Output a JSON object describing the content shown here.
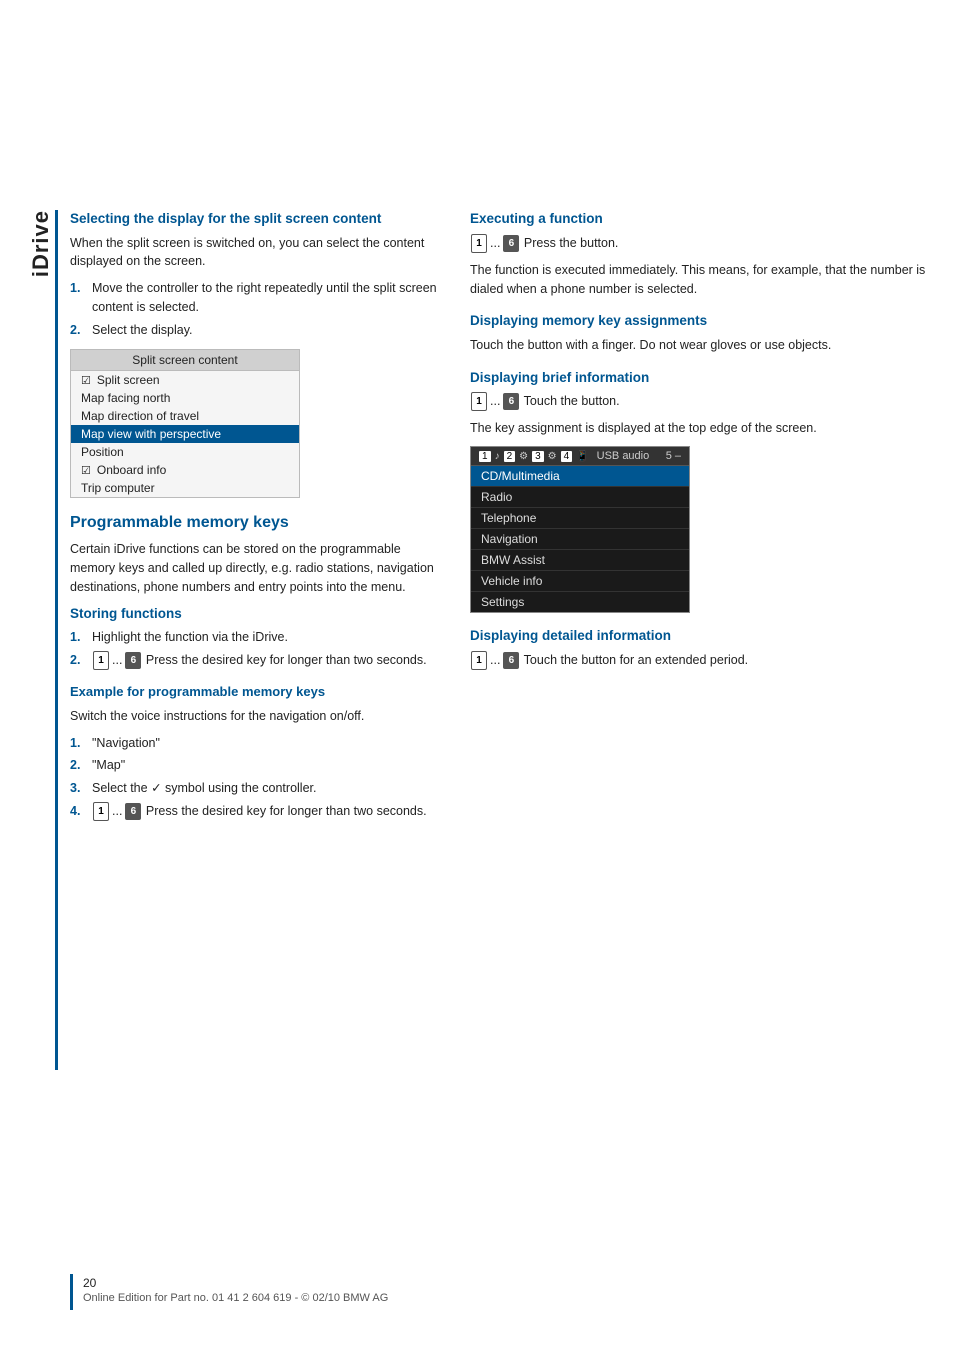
{
  "idrive_label": "iDrive",
  "left_column": {
    "section1": {
      "heading": "Selecting the display for the split screen content",
      "body": "When the split screen is switched on, you can select the content displayed on the screen.",
      "steps": [
        "Move the controller to the right repeatedly until the split screen content is selected.",
        "Select the display."
      ],
      "split_screen_menu": {
        "title": "Split screen content",
        "items": [
          {
            "text": "Split screen",
            "check": true,
            "highlighted": false
          },
          {
            "text": "Map facing north",
            "highlighted": false
          },
          {
            "text": "Map direction of travel",
            "highlighted": false
          },
          {
            "text": "Map view with perspective",
            "highlighted": true
          },
          {
            "text": "Position",
            "highlighted": false
          },
          {
            "text": "Onboard info",
            "check": true,
            "highlighted": false
          },
          {
            "text": "Trip computer",
            "highlighted": false
          }
        ]
      }
    },
    "section2": {
      "heading": "Programmable memory keys",
      "intro": "Certain iDrive functions can be stored on the programmable memory keys and called up directly, e.g. radio stations, navigation destinations, phone numbers and entry points into the menu.",
      "storing_heading": "Storing functions",
      "storing_steps": [
        "Highlight the function via the iDrive.",
        "Press the desired key for longer than two seconds."
      ],
      "example_heading": "Example for programmable memory keys",
      "example_body": "Switch the voice instructions for the navigation on/off.",
      "example_steps": [
        {
          "num": "1.",
          "text": "\"Navigation\""
        },
        {
          "num": "2.",
          "text": "\"Map\""
        },
        {
          "num": "3.",
          "text": "Select the ✓ symbol using the controller."
        },
        {
          "num": "4.",
          "text": "Press the desired key for longer than two seconds."
        }
      ]
    }
  },
  "right_column": {
    "section1": {
      "heading": "Executing a function",
      "instruction": "Press the button.",
      "body": "The function is executed immediately. This means, for example, that the number is dialed when a phone number is selected."
    },
    "section2": {
      "heading": "Displaying memory key assignments",
      "body": "Touch the button with a finger. Do not wear gloves or use objects."
    },
    "section3": {
      "heading": "Displaying brief information",
      "instruction": "Touch the button.",
      "body": "The key assignment is displayed at the top edge of the screen.",
      "nav_menu": {
        "header_items": [
          "1",
          "2",
          "3",
          "4",
          "USB audio",
          "5"
        ],
        "items": [
          {
            "text": "CD/Multimedia",
            "active": true
          },
          {
            "text": "Radio"
          },
          {
            "text": "Telephone"
          },
          {
            "text": "Navigation"
          },
          {
            "text": "BMW Assist"
          },
          {
            "text": "Vehicle info"
          },
          {
            "text": "Settings"
          }
        ]
      }
    },
    "section4": {
      "heading": "Displaying detailed information",
      "instruction": "Touch the button for an extended period."
    }
  },
  "footer": {
    "page_number": "20",
    "copyright": "Online Edition for Part no. 01 41 2 604 619 - © 02/10 BMW AG"
  },
  "key_labels": {
    "key1": "1",
    "key6": "6",
    "ellipsis": "..."
  }
}
